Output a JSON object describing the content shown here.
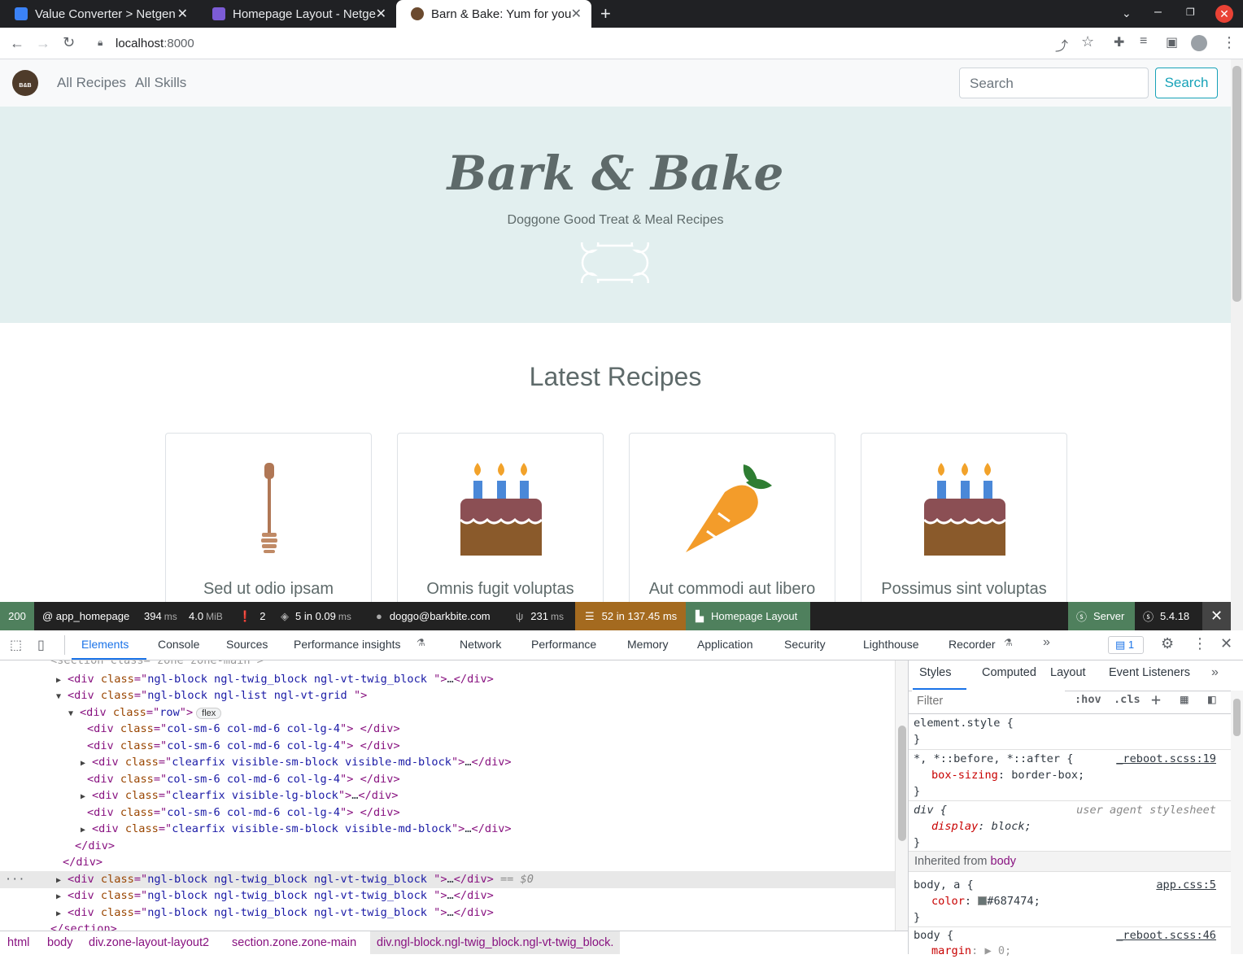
{
  "browser": {
    "tabs": [
      {
        "title": "Value Converter > Netgen",
        "active": false
      },
      {
        "title": "Homepage Layout - Netge",
        "active": false
      },
      {
        "title": "Barn & Bake: Yum for your",
        "active": true
      }
    ],
    "new_tab": "+",
    "url_host": "localhost",
    "url_port": ":8000"
  },
  "site": {
    "nav": {
      "all_recipes": "All Recipes",
      "all_skills": "All Skills"
    },
    "logo_text": "B&B",
    "search": {
      "placeholder": "Search",
      "button": "Search"
    },
    "hero": {
      "title": "Bark & Bake",
      "subtitle": "Doggone Good Treat & Meal Recipes"
    },
    "latest_title": "Latest Recipes",
    "recipes": [
      {
        "title": "Sed ut odio ipsam",
        "icon": "honey-dipper-icon"
      },
      {
        "title": "Omnis fugit voluptas",
        "icon": "birthday-cake-icon"
      },
      {
        "title": "Aut commodi aut libero",
        "icon": "carrot-icon"
      },
      {
        "title": "Possimus sint voluptas",
        "icon": "birthday-cake-icon"
      }
    ]
  },
  "symfony_toolbar": {
    "status": "200",
    "route": "@ app_homepage",
    "time": "394",
    "time_unit": "ms",
    "memory": "4.0",
    "memory_unit": "MiB",
    "logs": "2",
    "cache": "5 in 0.09",
    "cache_unit": "ms",
    "user": "doggo@barkbite.com",
    "twig": "231",
    "twig_unit": "ms",
    "db": "52 in 137.45 ms",
    "layout": "Homepage Layout",
    "server": "Server",
    "version": "5.4.18",
    "colors": {
      "status_bg": "#4f805d",
      "db_bg": "#a46a1f",
      "layout_bg": "#4f805d",
      "server_bg": "#4f805d"
    }
  },
  "devtools": {
    "tabs": [
      "Elements",
      "Console",
      "Sources",
      "Performance insights",
      "Network",
      "Performance",
      "Memory",
      "Application",
      "Security",
      "Lighthouse",
      "Recorder"
    ],
    "issues_count": "1",
    "styles_tabs": [
      "Styles",
      "Computed",
      "Layout",
      "Event Listeners"
    ],
    "filter_placeholder": "Filter",
    "hov": ":hov",
    "cls": ".cls",
    "breadcrumb": [
      "html",
      "body",
      "div.zone-layout-layout2",
      "section.zone.zone-main",
      "div.ngl-block.ngl-twig_block.ngl-vt-twig_block."
    ],
    "dom_lines": [
      {
        "indent": 0,
        "tri": "",
        "tag": "<section class=\"zone zone-main\">",
        "raw": true
      },
      {
        "indent": 1,
        "tri": "▶",
        "cls": "ngl-block ngl-twig_block ngl-vt-twig_block ",
        "ell": true
      },
      {
        "indent": 1,
        "tri": "▼",
        "cls": "ngl-block ngl-list ngl-vt-grid ",
        "open": true
      },
      {
        "indent": 2,
        "tri": "▼",
        "cls": "row",
        "open": true,
        "badge": "flex"
      },
      {
        "indent": 3,
        "tri": "",
        "cls": "col-sm-6 col-md-6 col-lg-4",
        "empty": true
      },
      {
        "indent": 3,
        "tri": "",
        "cls": "col-sm-6 col-md-6 col-lg-4",
        "empty": true
      },
      {
        "indent": 3,
        "tri": "▶",
        "cls": "clearfix visible-sm-block visible-md-block",
        "ell": true
      },
      {
        "indent": 3,
        "tri": "",
        "cls": "col-sm-6 col-md-6 col-lg-4",
        "empty": true
      },
      {
        "indent": 3,
        "tri": "▶",
        "cls": "clearfix visible-lg-block",
        "ell": true
      },
      {
        "indent": 3,
        "tri": "",
        "cls": "col-sm-6 col-md-6 col-lg-4",
        "empty": true
      },
      {
        "indent": 3,
        "tri": "▶",
        "cls": "clearfix visible-sm-block visible-md-block",
        "ell": true
      },
      {
        "indent": 2,
        "close": true
      },
      {
        "indent": 1,
        "close": true
      },
      {
        "indent": 1,
        "tri": "▶",
        "cls": "ngl-block ngl-twig_block ngl-vt-twig_block ",
        "ell": true,
        "selected": true,
        "suffix": " == $0"
      },
      {
        "indent": 1,
        "tri": "▶",
        "cls": "ngl-block ngl-twig_block ngl-vt-twig_block ",
        "ell": true
      },
      {
        "indent": 1,
        "tri": "▶",
        "cls": "ngl-block ngl-twig_block ngl-vt-twig_block ",
        "ell": true
      },
      {
        "indent": 0,
        "close_section": true
      }
    ],
    "styles_rules": {
      "element_style": "element.style {",
      "universal_selector": "*, *::before, *::after {",
      "universal_src": "_reboot.scss:19",
      "box_sizing_prop": "box-sizing",
      "box_sizing_val": "border-box;",
      "div_selector": "div {",
      "div_src": "user agent stylesheet",
      "display_prop": "display",
      "display_val": "block;",
      "inherited_label": "Inherited from",
      "inherited_from": "body",
      "body_a_selector": "body, a {",
      "body_a_src": "app.css:5",
      "color_prop": "color",
      "color_val": "#687474;",
      "body_selector": "body {",
      "body_src": "_reboot.scss:46",
      "margin_prop": "margin",
      "margin_val": "▶ 0;",
      "close": "}"
    }
  }
}
